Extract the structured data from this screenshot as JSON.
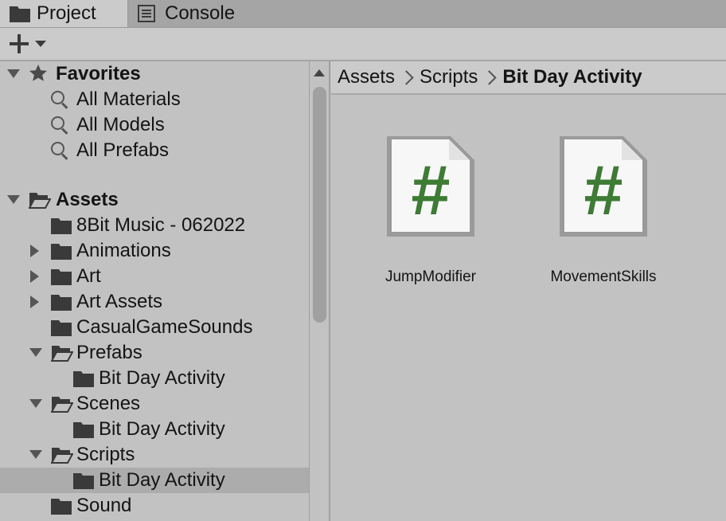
{
  "tabs": [
    {
      "label": "Project",
      "icon": "folder-icon",
      "active": true
    },
    {
      "label": "Console",
      "icon": "console-icon",
      "active": false
    }
  ],
  "toolbar": {
    "create_icon": "plus-icon",
    "dropdown_icon": "caret-down-icon"
  },
  "tree": {
    "favorites": {
      "label": "Favorites",
      "items": [
        "All Materials",
        "All Models",
        "All Prefabs"
      ]
    },
    "assets": {
      "label": "Assets",
      "items": [
        {
          "label": "8Bit Music - 062022"
        },
        {
          "label": "Animations"
        },
        {
          "label": "Art"
        },
        {
          "label": "Art Assets"
        },
        {
          "label": "CasualGameSounds"
        },
        {
          "label": "Prefabs"
        },
        {
          "label": "Bit Day Activity"
        },
        {
          "label": "Scenes"
        },
        {
          "label": "Bit Day Activity"
        },
        {
          "label": "Scripts"
        },
        {
          "label": "Bit Day Activity",
          "selected": true
        },
        {
          "label": "Sound"
        }
      ]
    }
  },
  "breadcrumb": [
    "Assets",
    "Scripts",
    "Bit Day Activity"
  ],
  "assets_grid": [
    {
      "name": "JumpModifier",
      "icon": "csharp-script-icon",
      "glyph": "#"
    },
    {
      "name": "MovementSkills",
      "icon": "csharp-script-icon",
      "glyph": "#"
    }
  ],
  "colors": {
    "script_hash": "#3e7b35",
    "selection": "#acacac",
    "panel": "#c2c2c2"
  }
}
